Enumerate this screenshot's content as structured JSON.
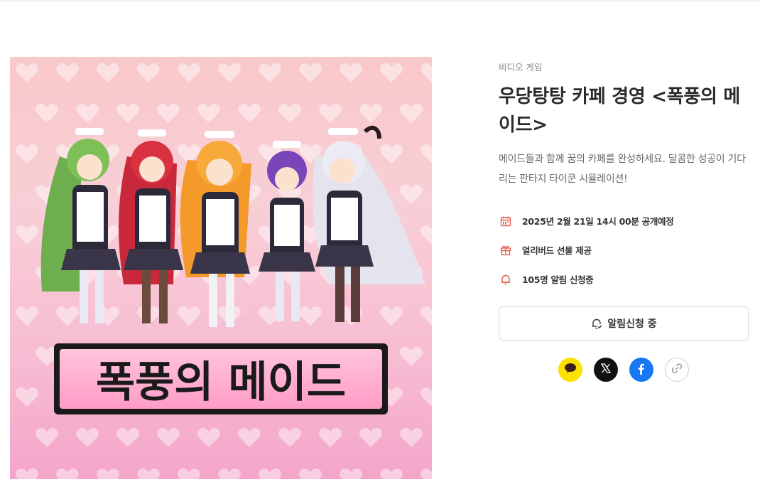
{
  "product": {
    "category": "비디오 게임",
    "title": "우당탕탕 카페 경영 <폭풍의 메이드>",
    "description": "메이드들과 함께 꿈의 카페를 완성하세요. 달콤한 성공이 기다리는 판타지 타이쿤 시뮬레이션!",
    "artwork_logo_text": "폭풍의 메이드"
  },
  "meta": {
    "release": "2025년 2월 21일 14시 00분 공개예정",
    "gift": "얼리버드 선물 제공",
    "alert_count": "105명 알림 신청중"
  },
  "notify_button": {
    "label": "알림신청 중"
  },
  "share": [
    "kakao-icon",
    "x-icon",
    "facebook-icon",
    "link-icon"
  ],
  "colors": {
    "accent": "#e35a4a",
    "kakao": "#fae100",
    "facebook": "#1877f2",
    "x": "#111111"
  }
}
